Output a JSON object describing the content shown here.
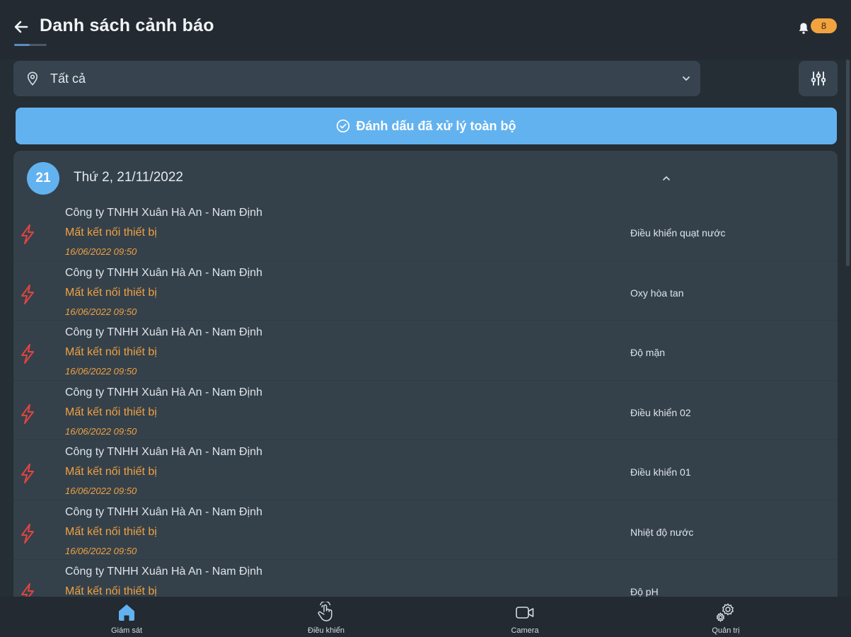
{
  "header": {
    "title": "Danh sách cảnh báo",
    "notification_count": "8"
  },
  "filter": {
    "location_value": "Tất cả"
  },
  "actions": {
    "mark_all_label": "Đánh dấu đã xử lý toàn bộ"
  },
  "group": {
    "day_number": "21",
    "date_label": "Thứ 2, 21/11/2022"
  },
  "alerts": [
    {
      "company": "Công ty TNHH Xuân Hà An - Nam Định",
      "status": "Mất kết nối thiết bị",
      "time": "16/06/2022 09:50",
      "device": "Điều khiển quạt nước"
    },
    {
      "company": "Công ty TNHH Xuân Hà An - Nam Định",
      "status": "Mất kết nối thiết bị",
      "time": "16/06/2022 09:50",
      "device": "Oxy hòa tan"
    },
    {
      "company": "Công ty TNHH Xuân Hà An - Nam Định",
      "status": "Mất kết nối thiết bị",
      "time": "16/06/2022 09:50",
      "device": "Độ mặn"
    },
    {
      "company": "Công ty TNHH Xuân Hà An - Nam Định",
      "status": "Mất kết nối thiết bị",
      "time": "16/06/2022 09:50",
      "device": "Điều khiển 02"
    },
    {
      "company": "Công ty TNHH Xuân Hà An - Nam Định",
      "status": "Mất kết nối thiết bị",
      "time": "16/06/2022 09:50",
      "device": "Điều khiển 01"
    },
    {
      "company": "Công ty TNHH Xuân Hà An - Nam Định",
      "status": "Mất kết nối thiết bị",
      "time": "16/06/2022 09:50",
      "device": "Nhiệt độ nước"
    },
    {
      "company": "Công ty TNHH Xuân Hà An - Nam Định",
      "status": "Mất kết nối thiết bị",
      "time": "",
      "device": "Độ pH"
    }
  ],
  "nav": [
    {
      "label": "Giám sát",
      "icon": "home-icon",
      "active": true
    },
    {
      "label": "Điều khiển",
      "icon": "touch-icon",
      "active": false
    },
    {
      "label": "Camera",
      "icon": "camera-icon",
      "active": false
    },
    {
      "label": "Quản trị",
      "icon": "settings-icon",
      "active": false
    }
  ],
  "colors": {
    "accent": "#62b2f0",
    "warning": "#f1a040",
    "alert_icon": "#e0443f",
    "background": "#252d35",
    "card": "#34414b"
  }
}
